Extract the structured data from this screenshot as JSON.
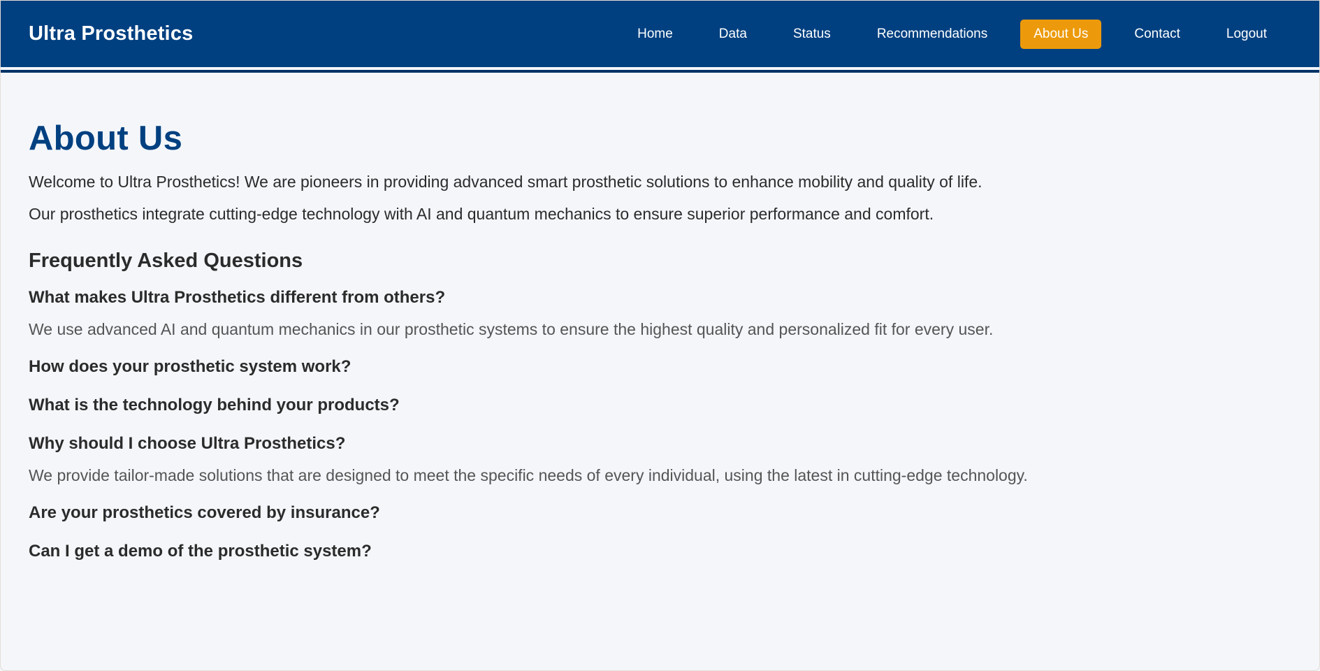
{
  "brand": "Ultra Prosthetics",
  "nav": {
    "items": [
      {
        "label": "Home"
      },
      {
        "label": "Data"
      },
      {
        "label": "Status"
      },
      {
        "label": "Recommendations"
      },
      {
        "label": "About Us",
        "active": true
      },
      {
        "label": "Contact"
      },
      {
        "label": "Logout"
      }
    ]
  },
  "main": {
    "title": "About Us",
    "intro": [
      "Welcome to Ultra Prosthetics! We are pioneers in providing advanced smart prosthetic solutions to enhance mobility and quality of life.",
      "Our prosthetics integrate cutting-edge technology with AI and quantum mechanics to ensure superior performance and comfort."
    ],
    "faq_heading": "Frequently Asked Questions",
    "faq": [
      {
        "q": "What makes Ultra Prosthetics different from others?",
        "a": "We use advanced AI and quantum mechanics in our prosthetic systems to ensure the highest quality and personalized fit for every user.",
        "expanded": true
      },
      {
        "q": "How does your prosthetic system work?",
        "a": "",
        "expanded": false
      },
      {
        "q": "What is the technology behind your products?",
        "a": "",
        "expanded": false
      },
      {
        "q": "Why should I choose Ultra Prosthetics?",
        "a": "We provide tailor-made solutions that are designed to meet the specific needs of every individual, using the latest in cutting-edge technology.",
        "expanded": true
      },
      {
        "q": "Are your prosthetics covered by insurance?",
        "a": "",
        "expanded": false
      },
      {
        "q": "Can I get a demo of the prosthetic system?",
        "a": "",
        "expanded": false
      }
    ]
  },
  "colors": {
    "nav_bg": "#004080",
    "active_tab": "#ec9a0c",
    "title": "#004080",
    "page_bg": "#f4f6fa"
  }
}
